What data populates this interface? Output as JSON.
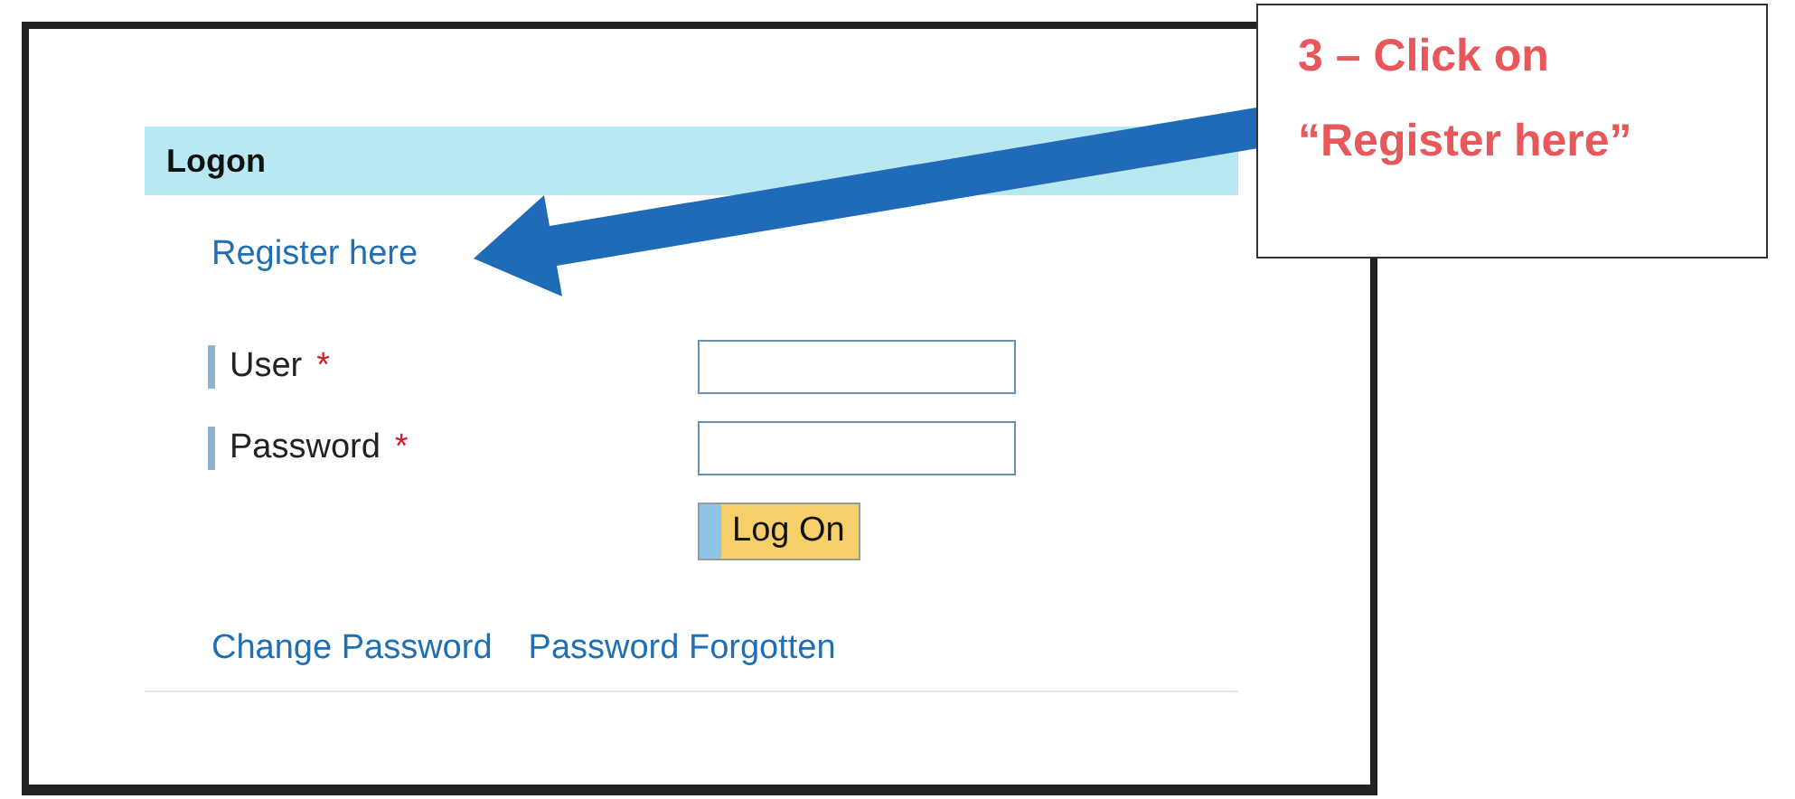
{
  "panel": {
    "title": "Logon",
    "register_link": "Register here",
    "fields": [
      {
        "label": "User",
        "required_mark": "*"
      },
      {
        "label": "Password",
        "required_mark": "*"
      }
    ],
    "button": "Log On",
    "links": [
      "Change Password",
      "Password Forgotten"
    ]
  },
  "callout": {
    "lines": [
      "3 – Click on",
      "“Register here”"
    ]
  }
}
